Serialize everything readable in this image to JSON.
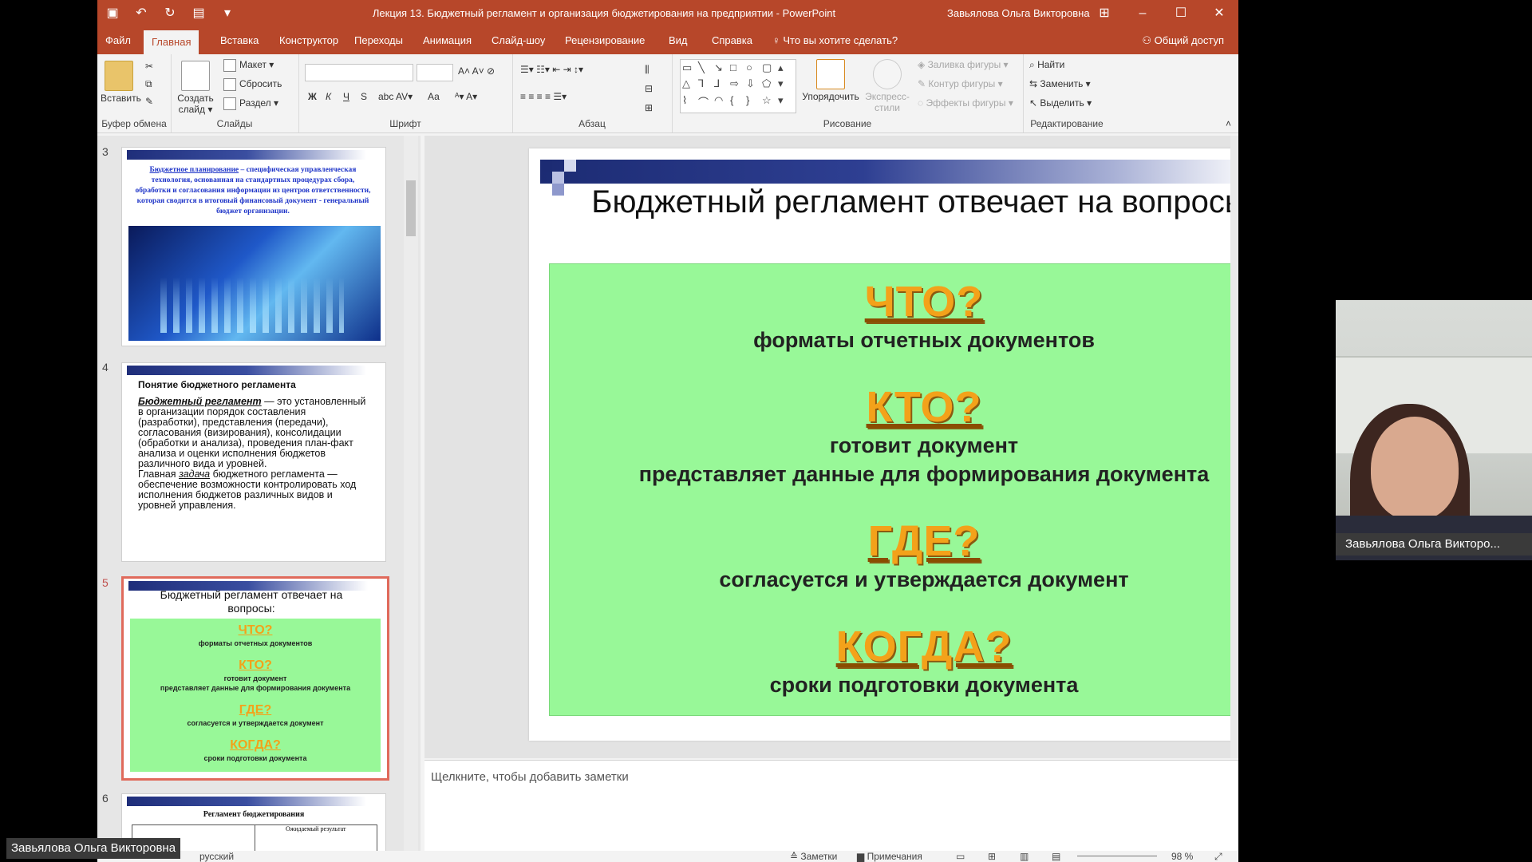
{
  "window": {
    "title": "Лекция 13. Бюджетный регламент и организация бюджетирования на предприятии  -  PowerPoint",
    "user": "Завьялова Ольга Викторовна"
  },
  "tabs": [
    {
      "label": "Файл"
    },
    {
      "label": "Главная"
    },
    {
      "label": "Вставка"
    },
    {
      "label": "Конструктор"
    },
    {
      "label": "Переходы"
    },
    {
      "label": "Анимация"
    },
    {
      "label": "Слайд-шоу"
    },
    {
      "label": "Рецензирование"
    },
    {
      "label": "Вид"
    },
    {
      "label": "Справка"
    },
    {
      "label": "Что вы хотите сделать?"
    }
  ],
  "share_label": "Общий доступ",
  "ribbon": {
    "clipboard": {
      "paste": "Вставить",
      "label": "Буфер обмена"
    },
    "slides": {
      "new_line1": "Создать",
      "new_line2": "слайд",
      "layout": "Макет",
      "reset": "Сбросить",
      "section": "Раздел",
      "label": "Слайды"
    },
    "font": {
      "label": "Шрифт",
      "bold": "Ж",
      "italic": "К",
      "underline": "Ч",
      "strike": "S",
      "case": "Аа"
    },
    "paragraph": {
      "label": "Абзац"
    },
    "drawing": {
      "arrange": "Упорядочить",
      "quick_line1": "Экспресс-",
      "quick_line2": "стили",
      "fill": "Заливка фигуры",
      "outline": "Контур фигуры",
      "effects": "Эффекты фигуры",
      "label": "Рисование"
    },
    "editing": {
      "find": "Найти",
      "replace": "Заменить",
      "select": "Выделить",
      "label": "Редактирование"
    }
  },
  "thumbnails": [
    {
      "number": "3",
      "text_link": "Бюджетное планирование",
      "text": " – специфическая управленческая технология, основанная на стандартных процедурах сбора, обработки и согласования информации из центров ответственности, которая сводится в итоговый финансовый документ - генеральный бюджет организации."
    },
    {
      "number": "4",
      "title": "Понятие бюджетного регламента",
      "term": "Бюджетный регламент",
      "p1": " — это установленный в организации порядок составления (разработки), представления (передачи), согласования (визирования), консолидации (обработки и анализа), проведения план-факт анализа и оценки исполнения бюджетов различного вида и уровней.",
      "p2_pre": "Главная ",
      "p2_em": "задача",
      "p2": " бюджетного регламента — обеспечение возможности контролировать ход исполнения бюджетов различных видов и уровней управления."
    },
    {
      "number": "5"
    },
    {
      "number": "6",
      "title": "Регламент бюджетирования",
      "col2": "Ожидаемый результат"
    }
  ],
  "slide": {
    "title": "Бюджетный регламент отвечает на вопросы:",
    "blocks": [
      {
        "q": "ЧТО?",
        "lines": [
          "форматы отчетных документов"
        ]
      },
      {
        "q": "КТО?",
        "lines": [
          "готовит документ",
          "представляет данные для формирования документа"
        ]
      },
      {
        "q": "ГДЕ?",
        "lines": [
          "согласуется и утверждается документ"
        ]
      },
      {
        "q": "КОГДА?",
        "lines": [
          "сроки подготовки документа"
        ]
      }
    ]
  },
  "notes_placeholder": "Щелкните, чтобы добавить заметки",
  "status": {
    "language": "русский",
    "notes": "Заметки",
    "comments": "Примечания",
    "zoom": "98 %"
  },
  "webcam": {
    "name": "Завьялова Ольга Викторо..."
  },
  "participant_label": "Завьялова Ольга Викторовна",
  "colors": {
    "accent": "#b7472a",
    "slide_green": "#98f898",
    "question_orange": "#f3a21a"
  }
}
